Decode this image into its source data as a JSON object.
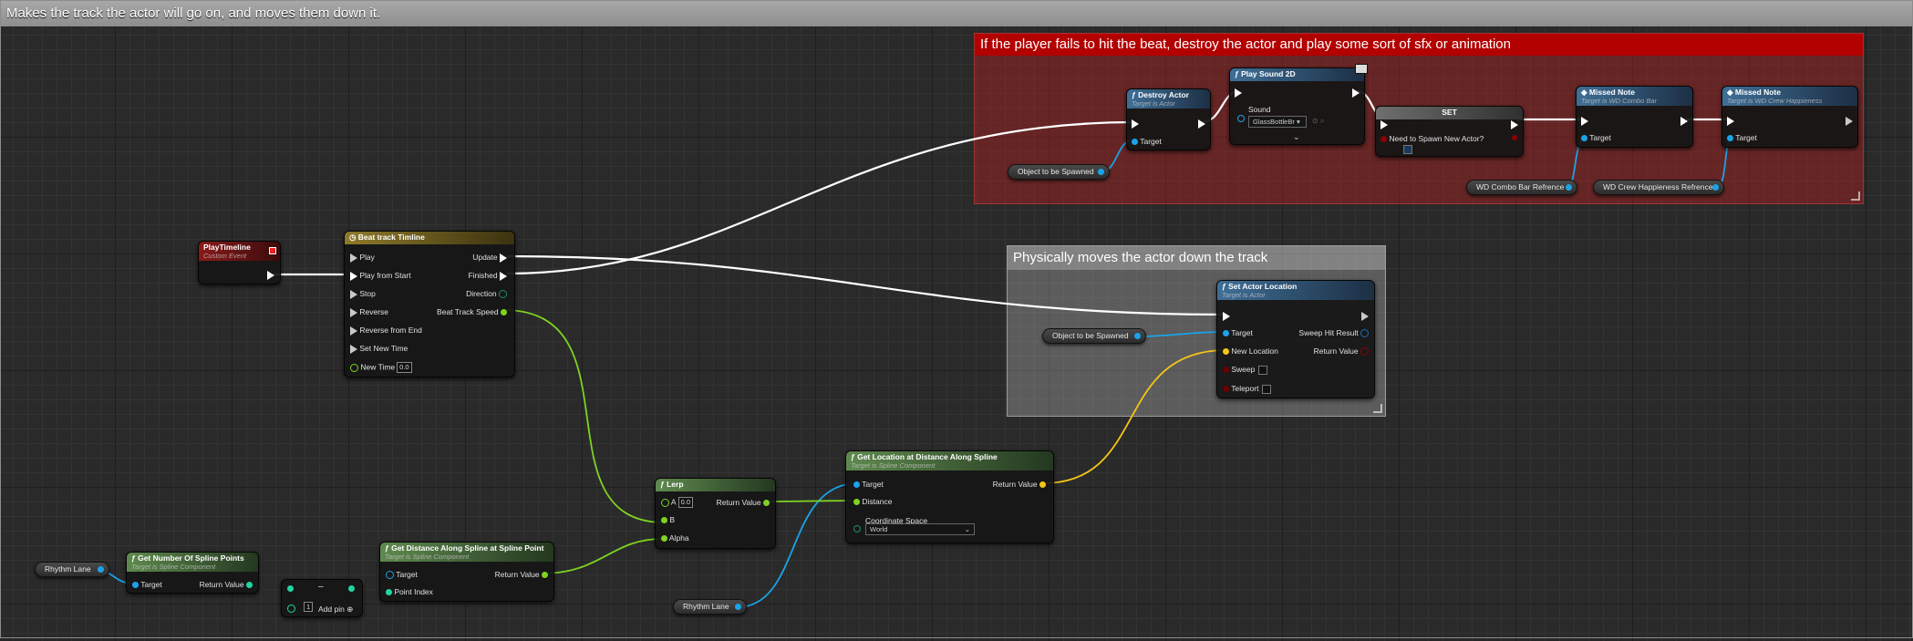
{
  "main_comment": "Makes the track the actor will go on, and moves them down it.",
  "comment_red": "If the player fails to hit the beat, destroy the actor and play some sort of sfx or animation",
  "comment_grey": "Physically moves the actor down the track",
  "colors": {
    "exec": "#ffffff",
    "object": "#1ba3e8",
    "float": "#7ed321",
    "vector": "#f5c518",
    "bool": "#8b0000",
    "red_comment": "#b00000"
  },
  "nodes": {
    "play_timeline": {
      "title": "PlayTimeline",
      "subtitle": "Custom Event"
    },
    "beat_track_timeline": {
      "title": "Beat track Timline",
      "inputs": [
        "Play",
        "Play from Start",
        "Stop",
        "Reverse",
        "Reverse from End",
        "Set New Time",
        "New Time"
      ],
      "new_time_value": "0.0",
      "outputs": [
        "Update",
        "Finished",
        "Direction",
        "Beat Track Speed"
      ]
    },
    "destroy_actor": {
      "title": "Destroy Actor",
      "subtitle": "Target is Actor",
      "pin_target": "Target"
    },
    "play_sound_2d": {
      "title": "Play Sound 2D",
      "pin_sound": "Sound",
      "sound_value": "GlassBottleBr"
    },
    "set_var": {
      "title": "SET",
      "pin": "Need to Spawn New Actor?"
    },
    "missed_note_1": {
      "title": "Missed Note",
      "subtitle": "Target is WD Combo Bar",
      "pin_target": "Target"
    },
    "missed_note_2": {
      "title": "Missed Note",
      "subtitle": "Target is WD Crew Happieness",
      "pin_target": "Target"
    },
    "set_actor_location": {
      "title": "Set Actor Location",
      "subtitle": "Target is Actor",
      "pin_target": "Target",
      "pin_new_location": "New Location",
      "pin_sweep": "Sweep",
      "pin_teleport": "Teleport",
      "out_sweep": "Sweep Hit Result",
      "out_return": "Return Value"
    },
    "lerp": {
      "title": "Lerp",
      "pin_a": "A",
      "a_value": "0.0",
      "pin_b": "B",
      "pin_alpha": "Alpha",
      "out": "Return Value"
    },
    "get_location": {
      "title": "Get Location at Distance Along Spline",
      "subtitle": "Target is Spline Component",
      "pin_target": "Target",
      "pin_distance": "Distance",
      "pin_coord": "Coordinate Space",
      "coord_value": "World",
      "out": "Return Value"
    },
    "get_num_points": {
      "title": "Get Number Of Spline Points",
      "subtitle": "Target is Spline Component",
      "pin_target": "Target",
      "out": "Return Value"
    },
    "subtract": {
      "value": "1",
      "add_pin": "Add pin"
    },
    "get_distance": {
      "title": "Get Distance Along Spline at Spline Point",
      "subtitle": "Target is Spline Component",
      "pin_target": "Target",
      "pin_point_index": "Point Index",
      "out": "Return Value"
    }
  },
  "variables": {
    "object_spawned_1": "Object to be Spawned",
    "object_spawned_2": "Object to be Spawned",
    "wd_combo": "WD Combo Bar Refrence",
    "wd_crew": "WD Crew Happieness Refrence",
    "rhythm_lane_1": "Rhythm Lane",
    "rhythm_lane_2": "Rhythm Lane"
  }
}
